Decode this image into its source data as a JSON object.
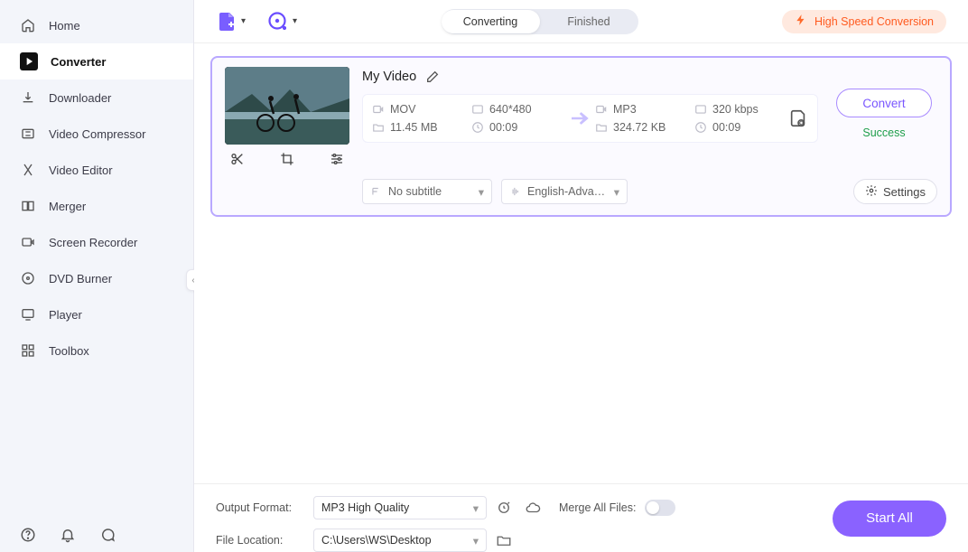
{
  "sidebar": {
    "items": [
      {
        "label": "Home",
        "icon": "home-icon"
      },
      {
        "label": "Converter",
        "icon": "converter-icon",
        "active": true
      },
      {
        "label": "Downloader",
        "icon": "download-icon"
      },
      {
        "label": "Video Compressor",
        "icon": "compress-icon"
      },
      {
        "label": "Video Editor",
        "icon": "editor-icon"
      },
      {
        "label": "Merger",
        "icon": "merger-icon"
      },
      {
        "label": "Screen Recorder",
        "icon": "recorder-icon"
      },
      {
        "label": "DVD Burner",
        "icon": "dvd-icon"
      },
      {
        "label": "Player",
        "icon": "player-icon"
      },
      {
        "label": "Toolbox",
        "icon": "toolbox-icon"
      }
    ]
  },
  "topbar": {
    "converting_label": "Converting",
    "finished_label": "Finished",
    "high_speed_label": "High Speed Conversion"
  },
  "task": {
    "title": "My Video",
    "source": {
      "format": "MOV",
      "resolution": "640*480",
      "size": "11.45 MB",
      "duration": "00:09"
    },
    "target": {
      "format": "MP3",
      "bitrate": "320 kbps",
      "size": "324.72 KB",
      "duration": "00:09"
    },
    "subtitle": "No subtitle",
    "audio": "English-Advan...",
    "settings_label": "Settings",
    "convert_label": "Convert",
    "status": "Success"
  },
  "bottom": {
    "output_format_label": "Output Format:",
    "output_format_value": "MP3 High Quality",
    "file_location_label": "File Location:",
    "file_location_value": "C:\\Users\\WS\\Desktop",
    "merge_label": "Merge All Files:",
    "start_all_label": "Start All"
  }
}
